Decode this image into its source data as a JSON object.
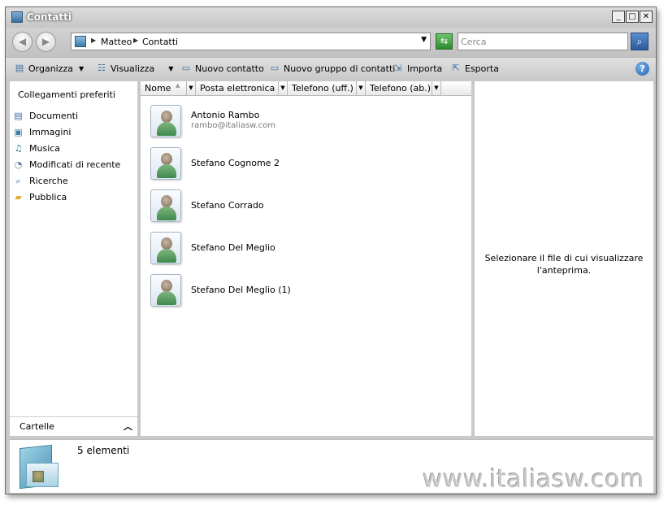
{
  "window": {
    "title": "Contatti"
  },
  "title_buttons": {
    "minimize": "_",
    "maximize": "□",
    "close": "✕"
  },
  "address": {
    "crumbs": [
      "Matteo",
      "Contatti"
    ],
    "search_placeholder": "Cerca"
  },
  "toolbar": {
    "organize": "Organizza",
    "view": "Visualizza",
    "new_contact": "Nuovo contatto",
    "new_group": "Nuovo gruppo di contatti",
    "import": "Importa",
    "export": "Esporta"
  },
  "nav": {
    "header": "Collegamenti preferiti",
    "items": [
      {
        "label": "Documenti",
        "icon": "documents-icon"
      },
      {
        "label": "Immagini",
        "icon": "pictures-icon"
      },
      {
        "label": "Musica",
        "icon": "music-icon"
      },
      {
        "label": "Modificati di recente",
        "icon": "recent-icon"
      },
      {
        "label": "Ricerche",
        "icon": "searches-icon"
      },
      {
        "label": "Pubblica",
        "icon": "public-folder-icon"
      }
    ],
    "folders": "Cartelle"
  },
  "columns": [
    "Nome",
    "Posta elettronica",
    "Telefono (uff.)",
    "Telefono (ab.)"
  ],
  "contacts": [
    {
      "name": "Antonio Rambo",
      "email": "rambo@italiasw.com"
    },
    {
      "name": "Stefano Cognome 2",
      "email": ""
    },
    {
      "name": "Stefano Corrado",
      "email": ""
    },
    {
      "name": "Stefano Del Meglio",
      "email": ""
    },
    {
      "name": "Stefano Del Meglio (1)",
      "email": ""
    }
  ],
  "preview": {
    "message": "Selezionare il file di cui visualizzare l'anteprima."
  },
  "details": {
    "count": "5 elementi"
  },
  "watermark": "www.italiasw.com"
}
